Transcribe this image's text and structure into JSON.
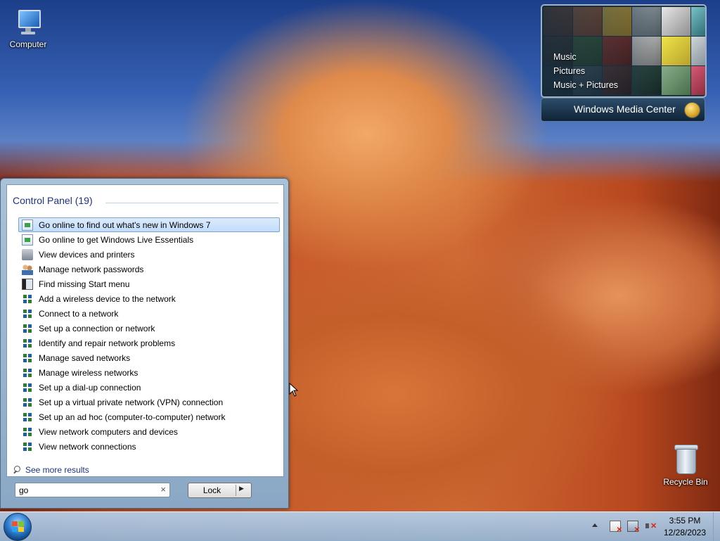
{
  "desktop": {
    "icons": [
      {
        "label": "Computer",
        "icon": "computer-icon"
      },
      {
        "label": "Recycle Bin",
        "icon": "recycle-bin-icon"
      }
    ]
  },
  "media_center": {
    "menu": [
      "Music",
      "Pictures",
      "Music + Pictures"
    ],
    "brand_bold": "Windows",
    "brand_light": "Media Center"
  },
  "start_menu": {
    "group_header": "Control Panel (19)",
    "results": [
      {
        "label": "Go online to find out what's new in Windows 7",
        "icon": "document-icon",
        "selected": true
      },
      {
        "label": "Go online to get Windows Live Essentials",
        "icon": "document-icon"
      },
      {
        "label": "View devices and printers",
        "icon": "printer-icon"
      },
      {
        "label": "Manage network passwords",
        "icon": "people-icon"
      },
      {
        "label": "Find missing Start menu",
        "icon": "start-menu-icon"
      },
      {
        "label": "Add a wireless device to the network",
        "icon": "network-icon"
      },
      {
        "label": "Connect to a network",
        "icon": "network-icon"
      },
      {
        "label": "Set up a connection or network",
        "icon": "network-icon"
      },
      {
        "label": "Identify and repair network problems",
        "icon": "network-icon"
      },
      {
        "label": "Manage saved networks",
        "icon": "network-icon"
      },
      {
        "label": "Manage wireless networks",
        "icon": "network-icon"
      },
      {
        "label": "Set up a dial-up connection",
        "icon": "network-icon"
      },
      {
        "label": "Set up a virtual private network (VPN) connection",
        "icon": "network-icon"
      },
      {
        "label": "Set up an ad hoc (computer-to-computer) network",
        "icon": "network-icon"
      },
      {
        "label": "View network computers and devices",
        "icon": "network-icon"
      },
      {
        "label": "View network connections",
        "icon": "network-icon"
      }
    ],
    "see_more": "See more results",
    "search_value": "go",
    "clear_glyph": "×",
    "lock_label": "Lock",
    "lock_arrow": "▶"
  },
  "taskbar": {
    "time": "3:55 PM",
    "date": "12/28/2023",
    "tray_icons": [
      "show-hidden-icons-icon",
      "action-center-icon",
      "network-icon",
      "volume-muted-icon"
    ]
  },
  "colors": {
    "header_blue": "#1e3287",
    "selection": "#c1dcfc"
  }
}
